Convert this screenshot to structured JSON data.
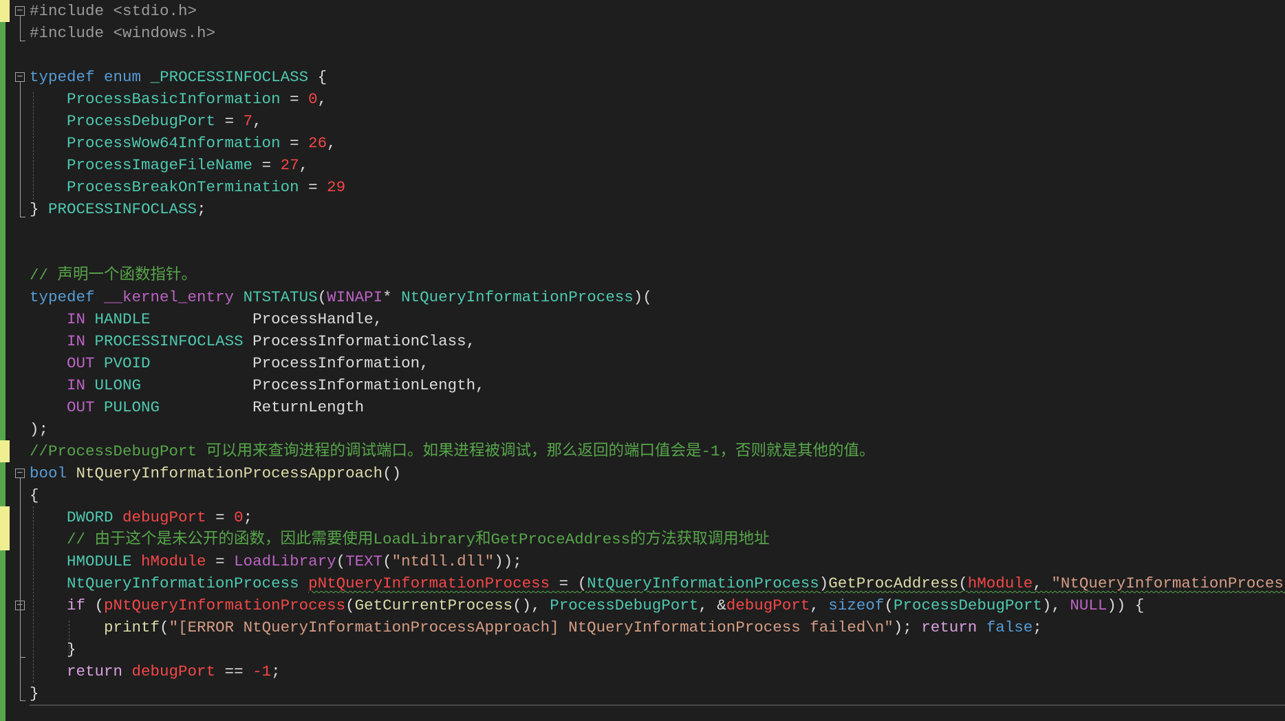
{
  "editor": {
    "language": "C++",
    "theme_colors": {
      "background": "#1e1e1e",
      "keyword": "#569cd6",
      "type": "#4ec9b0",
      "comment": "#57a64a",
      "macro": "#bd63c5",
      "function": "#dcdcaa",
      "local_variable": "#f44747",
      "string": "#d69d85",
      "number": "#f44747",
      "change_marker": "#efef91"
    },
    "fold_icon": "fold-collapse-icon",
    "lines": [
      [
        {
          "t": "#include <stdio.h>",
          "c": "pp"
        }
      ],
      [
        {
          "t": "#include <windows.h>",
          "c": "pp"
        }
      ],
      [],
      [
        {
          "t": "typedef",
          "c": "kw"
        },
        {
          "t": " ",
          "c": "tx"
        },
        {
          "t": "enum",
          "c": "kw"
        },
        {
          "t": " ",
          "c": "tx"
        },
        {
          "t": "_PROCESSINFOCLASS",
          "c": "ty"
        },
        {
          "t": " {",
          "c": "tx"
        }
      ],
      [
        {
          "t": "    ",
          "c": "tx"
        },
        {
          "t": "ProcessBasicInformation",
          "c": "ty"
        },
        {
          "t": " = ",
          "c": "tx"
        },
        {
          "t": "0",
          "c": "nm"
        },
        {
          "t": ",",
          "c": "tx"
        }
      ],
      [
        {
          "t": "    ",
          "c": "tx"
        },
        {
          "t": "ProcessDebugPort",
          "c": "ty"
        },
        {
          "t": " = ",
          "c": "tx"
        },
        {
          "t": "7",
          "c": "nm"
        },
        {
          "t": ",",
          "c": "tx"
        }
      ],
      [
        {
          "t": "    ",
          "c": "tx"
        },
        {
          "t": "ProcessWow64Information",
          "c": "ty"
        },
        {
          "t": " = ",
          "c": "tx"
        },
        {
          "t": "26",
          "c": "nm"
        },
        {
          "t": ",",
          "c": "tx"
        }
      ],
      [
        {
          "t": "    ",
          "c": "tx"
        },
        {
          "t": "ProcessImageFileName",
          "c": "ty"
        },
        {
          "t": " = ",
          "c": "tx"
        },
        {
          "t": "27",
          "c": "nm"
        },
        {
          "t": ",",
          "c": "tx"
        }
      ],
      [
        {
          "t": "    ",
          "c": "tx"
        },
        {
          "t": "ProcessBreakOnTermination",
          "c": "ty"
        },
        {
          "t": " = ",
          "c": "tx"
        },
        {
          "t": "29",
          "c": "nm"
        }
      ],
      [
        {
          "t": "} ",
          "c": "tx"
        },
        {
          "t": "PROCESSINFOCLASS",
          "c": "ty"
        },
        {
          "t": ";",
          "c": "tx"
        }
      ],
      [],
      [],
      [
        {
          "t": "// 声明一个函数指针。",
          "c": "cm"
        }
      ],
      [
        {
          "t": "typedef",
          "c": "kw"
        },
        {
          "t": " ",
          "c": "tx"
        },
        {
          "t": "__kernel_entry",
          "c": "mc"
        },
        {
          "t": " ",
          "c": "tx"
        },
        {
          "t": "NTSTATUS",
          "c": "ty"
        },
        {
          "t": "(",
          "c": "tx"
        },
        {
          "t": "WINAPI",
          "c": "mc"
        },
        {
          "t": "* ",
          "c": "tx"
        },
        {
          "t": "NtQueryInformationProcess",
          "c": "ty"
        },
        {
          "t": ")(",
          "c": "tx"
        }
      ],
      [
        {
          "t": "    ",
          "c": "tx"
        },
        {
          "t": "IN",
          "c": "mc"
        },
        {
          "t": " ",
          "c": "tx"
        },
        {
          "t": "HANDLE",
          "c": "ty"
        },
        {
          "t": "           ProcessHandle,",
          "c": "tx"
        }
      ],
      [
        {
          "t": "    ",
          "c": "tx"
        },
        {
          "t": "IN",
          "c": "mc"
        },
        {
          "t": " ",
          "c": "tx"
        },
        {
          "t": "PROCESSINFOCLASS",
          "c": "ty"
        },
        {
          "t": " ProcessInformationClass,",
          "c": "tx"
        }
      ],
      [
        {
          "t": "    ",
          "c": "tx"
        },
        {
          "t": "OUT",
          "c": "mc"
        },
        {
          "t": " ",
          "c": "tx"
        },
        {
          "t": "PVOID",
          "c": "ty"
        },
        {
          "t": "           ProcessInformation,",
          "c": "tx"
        }
      ],
      [
        {
          "t": "    ",
          "c": "tx"
        },
        {
          "t": "IN",
          "c": "mc"
        },
        {
          "t": " ",
          "c": "tx"
        },
        {
          "t": "ULONG",
          "c": "ty"
        },
        {
          "t": "            ProcessInformationLength,",
          "c": "tx"
        }
      ],
      [
        {
          "t": "    ",
          "c": "tx"
        },
        {
          "t": "OUT",
          "c": "mc"
        },
        {
          "t": " ",
          "c": "tx"
        },
        {
          "t": "PULONG",
          "c": "ty"
        },
        {
          "t": "          ReturnLength",
          "c": "tx"
        }
      ],
      [
        {
          "t": ");",
          "c": "tx"
        }
      ],
      [
        {
          "t": "//ProcessDebugPort 可以用来查询进程的调试端口。如果进程被调试，那么返回的端口值会是-1，否则就是其他的值。",
          "c": "cm"
        }
      ],
      [
        {
          "t": "bool",
          "c": "kw"
        },
        {
          "t": " ",
          "c": "tx"
        },
        {
          "t": "NtQueryInformationProcessApproach",
          "c": "fn"
        },
        {
          "t": "()",
          "c": "tx"
        }
      ],
      [
        {
          "t": "{",
          "c": "tx"
        }
      ],
      [
        {
          "t": "    ",
          "c": "tx"
        },
        {
          "t": "DWORD",
          "c": "ty"
        },
        {
          "t": " ",
          "c": "tx"
        },
        {
          "t": "debugPort",
          "c": "vr"
        },
        {
          "t": " = ",
          "c": "tx"
        },
        {
          "t": "0",
          "c": "nm"
        },
        {
          "t": ";",
          "c": "tx"
        }
      ],
      [
        {
          "t": "    ",
          "c": "tx"
        },
        {
          "t": "// 由于这个是未公开的函数，因此需要使用LoadLibrary和GetProceAddress的方法获取调用地址",
          "c": "cm"
        }
      ],
      [
        {
          "t": "    ",
          "c": "tx"
        },
        {
          "t": "HMODULE",
          "c": "ty"
        },
        {
          "t": " ",
          "c": "tx"
        },
        {
          "t": "hModule",
          "c": "vr"
        },
        {
          "t": " = ",
          "c": "tx"
        },
        {
          "t": "LoadLibrary",
          "c": "mc"
        },
        {
          "t": "(",
          "c": "tx"
        },
        {
          "t": "TEXT",
          "c": "mc"
        },
        {
          "t": "(",
          "c": "tx"
        },
        {
          "t": "\"ntdll.dll\"",
          "c": "st"
        },
        {
          "t": "));",
          "c": "tx"
        }
      ],
      [
        {
          "t": "    ",
          "c": "tx"
        },
        {
          "t": "NtQueryInformationProcess",
          "c": "ty"
        },
        {
          "t": " ",
          "c": "tx"
        },
        {
          "t": "pNtQueryInformationProcess",
          "c": "vr",
          "s": 1
        },
        {
          "t": " = (",
          "c": "tx",
          "s": 1
        },
        {
          "t": "NtQueryInformationProcess",
          "c": "ty",
          "s": 1
        },
        {
          "t": ")",
          "c": "tx",
          "s": 1
        },
        {
          "t": "GetProcAddress",
          "c": "fn",
          "s": 1
        },
        {
          "t": "(",
          "c": "tx",
          "s": 1
        },
        {
          "t": "hModule",
          "c": "vr",
          "s": 1
        },
        {
          "t": ", ",
          "c": "tx",
          "s": 1
        },
        {
          "t": "\"NtQueryInformationProcess\"",
          "c": "st",
          "s": 1
        },
        {
          "t": ");",
          "c": "tx"
        }
      ],
      [
        {
          "t": "    ",
          "c": "tx"
        },
        {
          "t": "if",
          "c": "ct"
        },
        {
          "t": " (",
          "c": "tx"
        },
        {
          "t": "pNtQueryInformationProcess",
          "c": "vr"
        },
        {
          "t": "(",
          "c": "tx"
        },
        {
          "t": "GetCurrentProcess",
          "c": "fn"
        },
        {
          "t": "(), ",
          "c": "tx"
        },
        {
          "t": "ProcessDebugPort",
          "c": "ty"
        },
        {
          "t": ", &",
          "c": "tx"
        },
        {
          "t": "debugPort",
          "c": "vr"
        },
        {
          "t": ", ",
          "c": "tx"
        },
        {
          "t": "sizeof",
          "c": "kw"
        },
        {
          "t": "(",
          "c": "tx"
        },
        {
          "t": "ProcessDebugPort",
          "c": "ty"
        },
        {
          "t": "), ",
          "c": "tx"
        },
        {
          "t": "NULL",
          "c": "mc"
        },
        {
          "t": ")) {",
          "c": "tx"
        }
      ],
      [
        {
          "t": "        ",
          "c": "tx"
        },
        {
          "t": "printf",
          "c": "fn"
        },
        {
          "t": "(",
          "c": "tx"
        },
        {
          "t": "\"[ERROR NtQueryInformationProcessApproach] NtQueryInformationProcess failed\\n\"",
          "c": "st"
        },
        {
          "t": "); ",
          "c": "tx"
        },
        {
          "t": "return",
          "c": "ct"
        },
        {
          "t": " ",
          "c": "tx"
        },
        {
          "t": "false",
          "c": "kw"
        },
        {
          "t": ";",
          "c": "tx"
        }
      ],
      [
        {
          "t": "    }",
          "c": "tx"
        }
      ],
      [
        {
          "t": "    ",
          "c": "tx"
        },
        {
          "t": "return",
          "c": "ct"
        },
        {
          "t": " ",
          "c": "tx"
        },
        {
          "t": "debugPort",
          "c": "vr"
        },
        {
          "t": " == ",
          "c": "tx"
        },
        {
          "t": "-1",
          "c": "nm"
        },
        {
          "t": ";",
          "c": "tx"
        }
      ],
      [
        {
          "t": "}",
          "c": "tx"
        }
      ]
    ]
  }
}
